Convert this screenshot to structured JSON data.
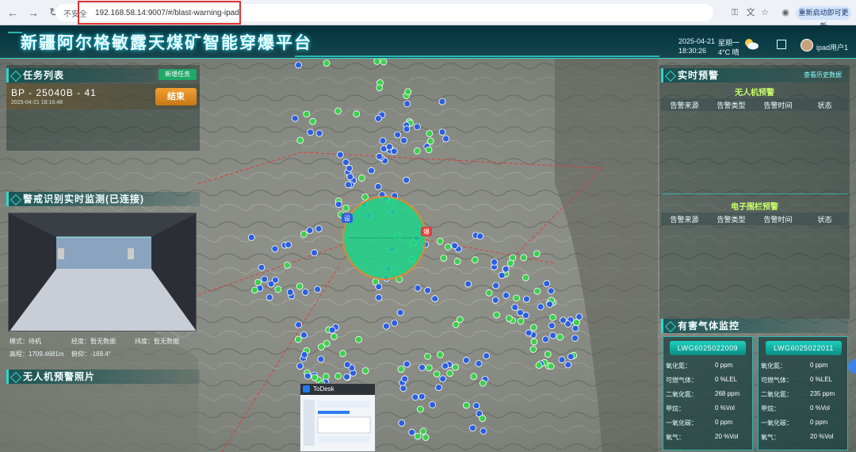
{
  "browser": {
    "security_label": "不安全",
    "url": "192.168.58.14:9007/#/blast-warning-ipad",
    "update_button": "重新启动即可更新"
  },
  "header": {
    "title": "新疆阿尔格敏露天煤矿智能穿爆平台",
    "date": "2025-04-21",
    "time": "18:30:26",
    "weekday": "星期一",
    "weather": "4°C 晴",
    "user": "ipad用户1"
  },
  "task_panel": {
    "title": "任务列表",
    "new_task_button": "新增任务",
    "task_id": "BP - 25040B - 41",
    "task_time": "2025-04-21 18:16:48",
    "end_button": "结束"
  },
  "video_panel": {
    "title": "警戒识别实时监测(已连接)",
    "mode_label": "模式：",
    "mode_value": "待机",
    "longitude_label": "经度：",
    "longitude_value": "暂无数据",
    "latitude_label": "纬度：",
    "latitude_value": "暂无数据",
    "altitude_label": "高程：",
    "altitude_value": "1709.4681m",
    "pitch_label": "俯仰：",
    "pitch_value": "-169.4°"
  },
  "photo_panel": {
    "title": "无人机预警照片"
  },
  "alert_panel": {
    "title": "实时预警",
    "history_link": "查看历史数据",
    "drone_section": "无人机预警",
    "fence_section": "电子围栏预警",
    "columns": [
      "告警来源",
      "告警类型",
      "告警时间",
      "状态"
    ]
  },
  "gas_panel": {
    "title": "有害气体监控",
    "sensors": [
      {
        "id": "LWG6025022009",
        "rows": [
          {
            "label": "氧化氮：",
            "value": "0",
            "unit": "ppm"
          },
          {
            "label": "可燃气体：",
            "value": "0",
            "unit": "%LEL"
          },
          {
            "label": "二氧化氮：",
            "value": "268",
            "unit": "ppm"
          },
          {
            "label": "甲烷：",
            "value": "0",
            "unit": "%Vol"
          },
          {
            "label": "一氧化碳：",
            "value": "0",
            "unit": "ppm"
          },
          {
            "label": "氧气：",
            "value": "20",
            "unit": "%Vol"
          }
        ]
      },
      {
        "id": "LWG6025022011",
        "rows": [
          {
            "label": "氧化氮：",
            "value": "0",
            "unit": "ppm"
          },
          {
            "label": "可燃气体：",
            "value": "0",
            "unit": "%LEL"
          },
          {
            "label": "二氧化氮：",
            "value": "235",
            "unit": "ppm"
          },
          {
            "label": "甲烷：",
            "value": "0",
            "unit": "%Vol"
          },
          {
            "label": "一氧化碳：",
            "value": "0",
            "unit": "ppm"
          },
          {
            "label": "氧气：",
            "value": "20",
            "unit": "%Vol"
          }
        ]
      }
    ]
  },
  "map": {
    "blast_label": "爆",
    "marker_labels": [
      "设",
      "安"
    ]
  },
  "todesk": {
    "title": "ToDesk"
  },
  "colors": {
    "accent": "#2fd6d0",
    "marker_green": "#3ccf4e",
    "marker_blue": "#2c5fe0",
    "blast_zone": "#1fd38a",
    "end_button": "#f0a030"
  }
}
